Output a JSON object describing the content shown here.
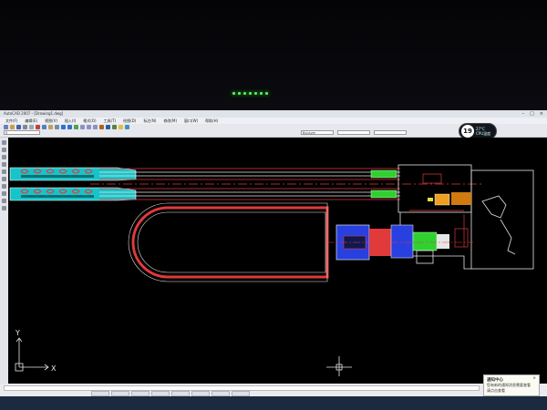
{
  "app": {
    "title": "AutoCAD 2007 - [Drawing1.dwg]",
    "window_controls": [
      "–",
      "□",
      "×"
    ]
  },
  "menu": {
    "items": [
      "文件(F)",
      "编辑(E)",
      "视图(V)",
      "插入(I)",
      "格式(O)",
      "工具(T)",
      "绘图(D)",
      "标注(N)",
      "修改(M)",
      "窗口(W)",
      "帮助(H)"
    ]
  },
  "toolbar": {
    "layer_field": "0",
    "style_field": "ByLayer"
  },
  "weather": {
    "badge": "19",
    "temp": "27°C",
    "label": "CPU温度"
  },
  "ucs": {
    "x_label": "X",
    "y_label": "Y"
  },
  "notification": {
    "title": "通知中心",
    "line1": "您有新的通知消息需要查看",
    "line2": "请点击查看",
    "close": "×"
  },
  "colors": {
    "cyan": "#19c3c8",
    "red": "#e03a3a",
    "green": "#2fd12f",
    "blue": "#2840e0",
    "yellow": "#f0e040",
    "white": "#e6e6e6"
  }
}
